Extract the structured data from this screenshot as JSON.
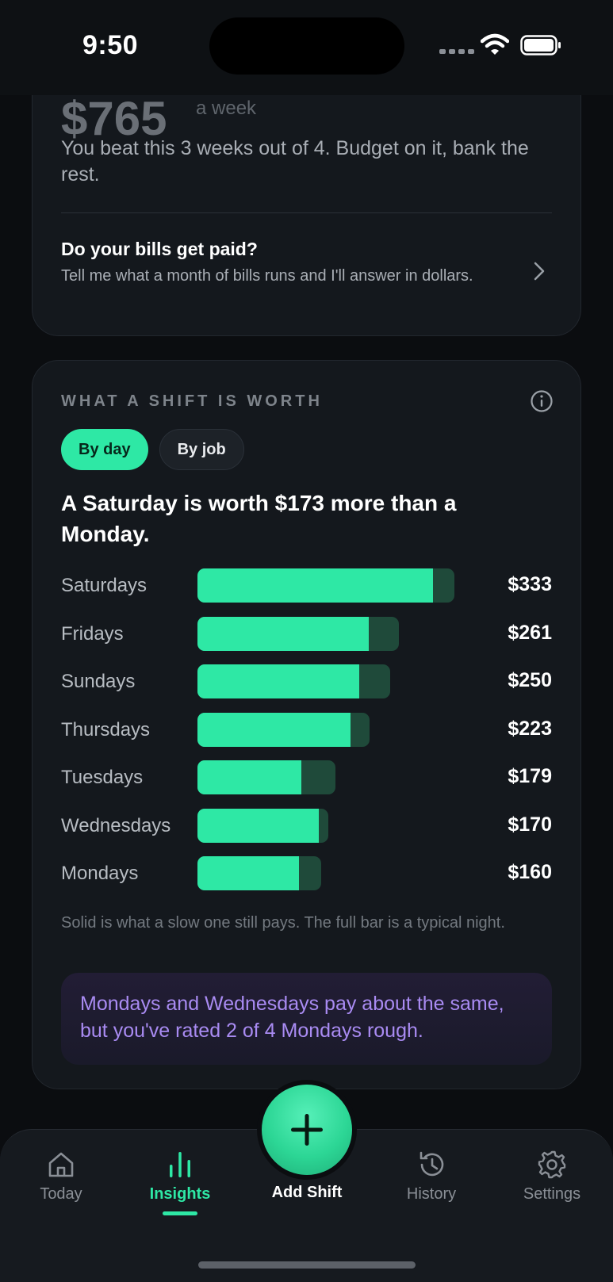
{
  "status": {
    "time": "9:50"
  },
  "summary": {
    "amount": "$765",
    "per_week": "a week",
    "beat_text": "You beat this 3 weeks out of 4. Budget on it, bank the rest.",
    "bills_title": "Do your bills get paid?",
    "bills_subtitle": "Tell me what a month of bills runs and I'll answer in dollars."
  },
  "shift_worth": {
    "header": "WHAT A SHIFT IS WORTH",
    "tabs": [
      {
        "label": "By day",
        "active": true
      },
      {
        "label": "By job",
        "active": false
      }
    ],
    "headline": "A Saturday is worth $173 more than a Monday.",
    "caption": "Solid is what a slow one still pays. The full bar is a typical night.",
    "insight": "Mondays and Wednesdays pay about the same, but you've rated 2 of 4 Mondays rough."
  },
  "chart_data": {
    "type": "bar",
    "orientation": "horizontal",
    "categories": [
      "Saturdays",
      "Fridays",
      "Sundays",
      "Thursdays",
      "Tuesdays",
      "Wednesdays",
      "Mondays"
    ],
    "value_labels": [
      "$333",
      "$261",
      "$250",
      "$223",
      "$179",
      "$170",
      "$160"
    ],
    "values": [
      333,
      261,
      250,
      223,
      179,
      170,
      160
    ],
    "solid_values": [
      305,
      222,
      210,
      198,
      135,
      157,
      132
    ],
    "xlim": [
      0,
      333
    ],
    "colors": {
      "solid": "#2ee8a5",
      "full": "#1f4a3a"
    }
  },
  "tab_bar": {
    "tabs": [
      {
        "label": "Today",
        "icon": "home-icon",
        "active": false
      },
      {
        "label": "Insights",
        "icon": "bar-chart-icon",
        "active": true
      },
      {
        "label": "History",
        "icon": "history-icon",
        "active": false
      },
      {
        "label": "Settings",
        "icon": "gear-icon",
        "active": false
      }
    ],
    "add_label": "Add Shift"
  },
  "colors": {
    "accent": "#2ee8a5",
    "insight": "#a98bf2",
    "background": "#0b0d10"
  }
}
